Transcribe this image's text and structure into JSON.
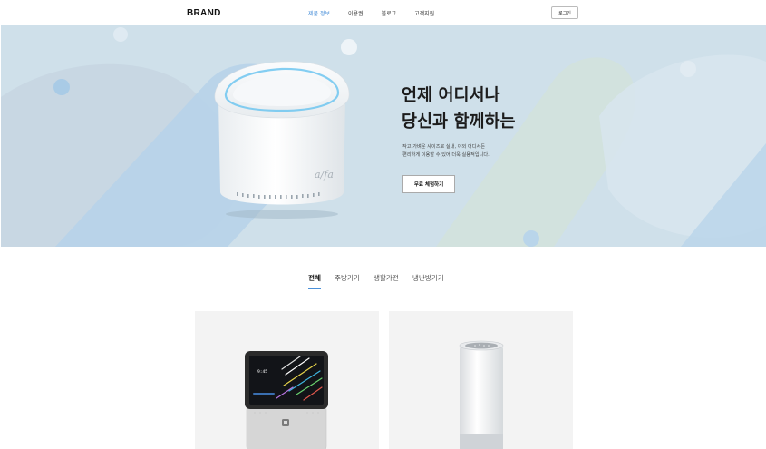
{
  "header": {
    "brand": "BRAND",
    "nav": [
      {
        "label": "제품 정보",
        "active": true
      },
      {
        "label": "이용권",
        "active": false
      },
      {
        "label": "블로그",
        "active": false
      },
      {
        "label": "고객지원",
        "active": false
      }
    ],
    "login_label": "로그인"
  },
  "hero": {
    "title_line1": "언제 어디서나",
    "title_line2": "당신과 함께하는",
    "desc_line1": "작고 가벼운 사이즈로 실내, 야외 어디서든",
    "desc_line2": "편리하게 이용할 수 있어 더욱 실용적입니다.",
    "cta_label": "무료 체험하기",
    "device_logo": "a/fa"
  },
  "tabs": [
    {
      "label": "전체",
      "active": true
    },
    {
      "label": "주방기기",
      "active": false
    },
    {
      "label": "생활가전",
      "active": false
    },
    {
      "label": "냉난방기기",
      "active": false
    }
  ],
  "products": {
    "card1_clock": "9:45"
  },
  "colors": {
    "accent": "#4a90d9",
    "hero_bg": "#cfe0ea"
  }
}
